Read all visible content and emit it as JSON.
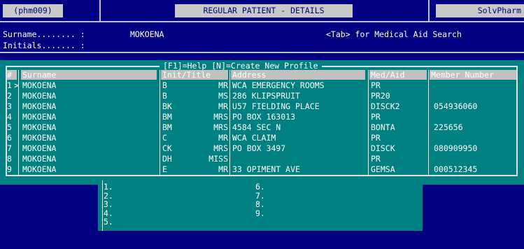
{
  "topbar": {
    "program_id": "(phm009)",
    "screen_title": "REGULAR PATIENT - DETAILS",
    "app_name": "SolvPharm"
  },
  "search": {
    "surname_label": "Surname........ :",
    "surname_value": "MOKOENA",
    "initials_label": "Initials....... :",
    "hint": "<Tab> for Medical Aid Search"
  },
  "profile_box": {
    "title": "[F1]=Help [N]=Create New Profile",
    "headers": [
      "#",
      "Surname",
      "Init/Title",
      "Address",
      "Med/Aid",
      "Member Number"
    ],
    "rows": [
      {
        "num": "1",
        "marker": ">",
        "surname": "MOKOENA",
        "init": "B",
        "title": "MR",
        "address": "WCA EMERGENCY ROOMS",
        "medaid": "PR",
        "member": ""
      },
      {
        "num": "2",
        "marker": "",
        "surname": "MOKOENA",
        "init": "B",
        "title": "MS",
        "address": "286 KLIPSPRUIT",
        "medaid": "PR20",
        "member": ""
      },
      {
        "num": "3",
        "marker": "",
        "surname": "MOKOENA",
        "init": "BK",
        "title": "MR",
        "address": "U57 FIELDING PLACE",
        "medaid": "DISCK2",
        "member": "054936060"
      },
      {
        "num": "4",
        "marker": "",
        "surname": "MOKOENA",
        "init": "BM",
        "title": "MRS",
        "address": "PO BOX 163013",
        "medaid": "PR",
        "member": ""
      },
      {
        "num": "5",
        "marker": "",
        "surname": "MOKOENA",
        "init": "BM",
        "title": "MRS",
        "address": "4584 SEC N",
        "medaid": "BONTA",
        "member": "225656"
      },
      {
        "num": "6",
        "marker": "",
        "surname": "MOKOENA",
        "init": "C",
        "title": "MR",
        "address": "WCA CLAIM",
        "medaid": "PR",
        "member": ""
      },
      {
        "num": "7",
        "marker": "",
        "surname": "MOKOENA",
        "init": "CK",
        "title": "MRS",
        "address": "PO BOX 3497",
        "medaid": "DISCK",
        "member": "080909950"
      },
      {
        "num": "8",
        "marker": "",
        "surname": "MOKOENA",
        "init": "DH",
        "title": "MISS",
        "address": "",
        "medaid": "PR",
        "member": ""
      },
      {
        "num": "9",
        "marker": "",
        "surname": "MOKOENA",
        "init": "E",
        "title": "MR",
        "address": "33 OPIMENT AVE",
        "medaid": "GEMSA",
        "member": "000512345"
      }
    ]
  },
  "slots": {
    "left": [
      "1.",
      "2.",
      "3.",
      "4.",
      "5."
    ],
    "right": [
      "6.",
      "7.",
      "8.",
      "9."
    ]
  },
  "colors": {
    "background": "#000080",
    "panel": "#008080",
    "header_bar": "#c0c0c0"
  }
}
